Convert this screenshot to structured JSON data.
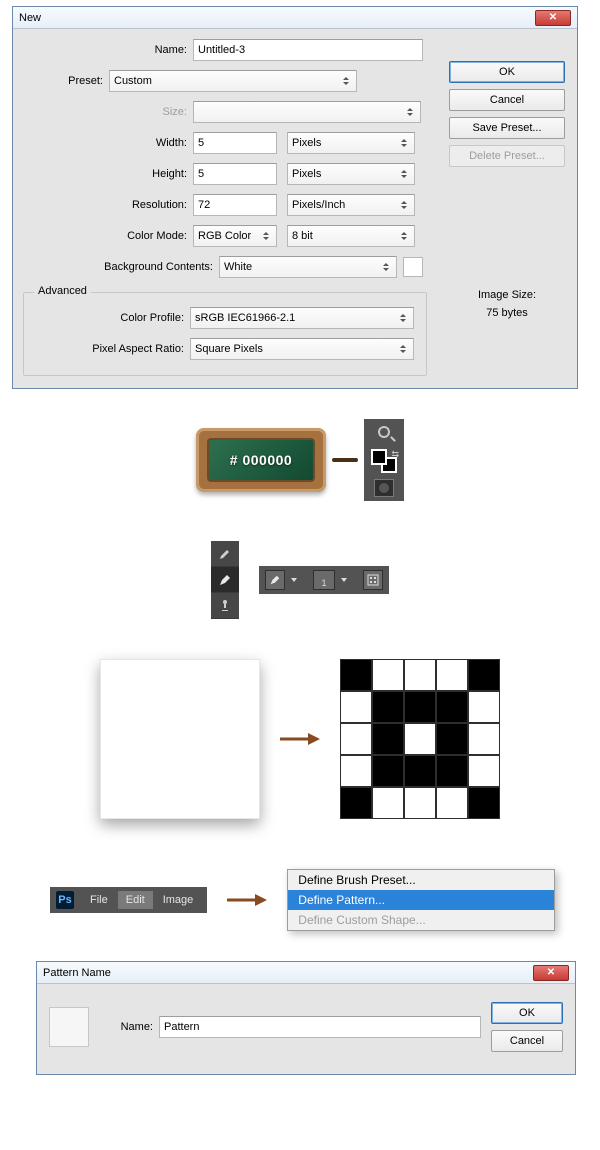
{
  "new_dialog": {
    "title": "New",
    "name_label": "Name:",
    "name_value": "Untitled-3",
    "preset_label": "Preset:",
    "preset_value": "Custom",
    "size_label": "Size:",
    "size_value": "",
    "width_label": "Width:",
    "width_value": "5",
    "width_unit": "Pixels",
    "height_label": "Height:",
    "height_value": "5",
    "height_unit": "Pixels",
    "resolution_label": "Resolution:",
    "resolution_value": "72",
    "resolution_unit": "Pixels/Inch",
    "colormode_label": "Color Mode:",
    "colormode_value": "RGB Color",
    "colormode_depth": "8 bit",
    "bgcontents_label": "Background Contents:",
    "bgcontents_value": "White",
    "advanced_legend": "Advanced",
    "colorprofile_label": "Color Profile:",
    "colorprofile_value": "sRGB IEC61966-2.1",
    "par_label": "Pixel Aspect Ratio:",
    "par_value": "Square Pixels",
    "ok_label": "OK",
    "cancel_label": "Cancel",
    "savepreset_label": "Save Preset...",
    "deletepreset_label": "Delete Preset...",
    "imgsize_label": "Image Size:",
    "imgsize_value": "75 bytes"
  },
  "chalkboard": {
    "hex": "# 000000"
  },
  "optbar": {
    "brush_size": "1"
  },
  "menubar": {
    "ps": "Ps",
    "file": "File",
    "edit": "Edit",
    "image": "Image"
  },
  "ctxmenu": {
    "brush": "Define Brush Preset...",
    "pattern": "Define Pattern...",
    "shape": "Define Custom Shape..."
  },
  "pattern_dialog": {
    "title": "Pattern Name",
    "name_label": "Name:",
    "name_value": "Pattern",
    "ok_label": "OK",
    "cancel_label": "Cancel"
  }
}
